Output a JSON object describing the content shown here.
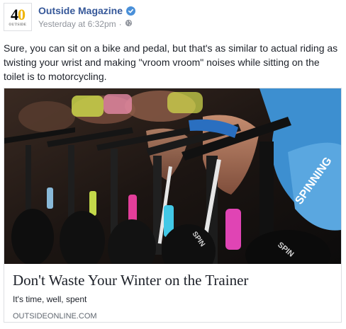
{
  "post": {
    "author": "Outside Magazine",
    "avatar": {
      "number": "40",
      "subtitle": "OUTSIDE"
    },
    "timestamp": "Yesterday at 6:32pm",
    "separator": "·",
    "privacy_icon": "globe-icon",
    "verified_icon": "verified-check-icon",
    "body": "Sure, you can sit on a bike and pedal, but that's as similar to actual riding as twisting your wrist and making \"vroom vroom\" noises while sitting on the toilet is to motorcycling."
  },
  "link": {
    "image_alt": "Spin class riders on stationary bikes",
    "bike_brand": "SPINNING",
    "title": "Don't Waste Your Winter on the Trainer",
    "description": "It's time, well, spent",
    "domain": "OUTSIDEONLINE.COM"
  },
  "colors": {
    "link_blue": "#365899",
    "muted": "#90949c",
    "verified": "#4a90d9",
    "card_border": "#dddfe2"
  }
}
